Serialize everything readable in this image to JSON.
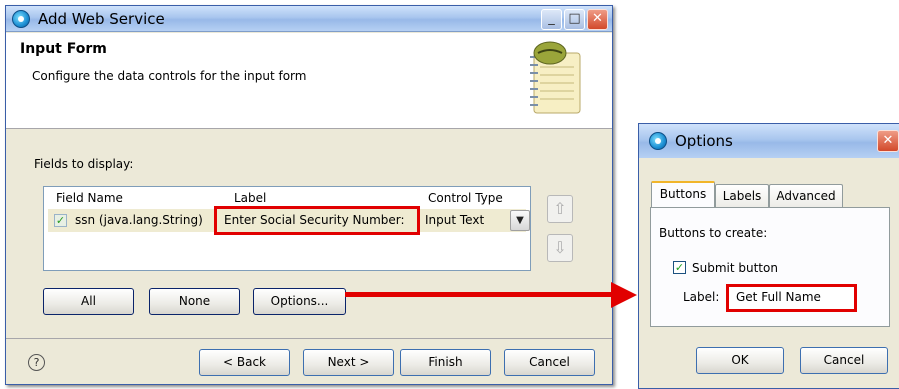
{
  "main": {
    "title": "Add Web Service",
    "header_title": "Input Form",
    "header_desc": "Configure the data controls for the input form",
    "fields_label": "Fields to display:",
    "columns": [
      "Field Name",
      "Label",
      "Control Type"
    ],
    "row": {
      "field_name": "ssn (java.lang.String)",
      "label": "Enter Social Security Number:",
      "control_type": "Input Text"
    },
    "buttons": {
      "all": "All",
      "none": "None",
      "options": "Options..."
    },
    "footer": {
      "back": "< Back",
      "next": "Next >",
      "finish": "Finish",
      "cancel": "Cancel"
    }
  },
  "options": {
    "title": "Options",
    "tabs": [
      "Buttons",
      "Labels",
      "Advanced"
    ],
    "buttons_to_create": "Buttons to create:",
    "submit_checkbox": "Submit button",
    "label_caption": "Label:",
    "label_value": "Get Full Name",
    "ok": "OK",
    "cancel": "Cancel"
  },
  "icons": {
    "title": "web-service-icon",
    "help": "help-icon",
    "up": "arrow-up-icon",
    "down": "arrow-down-icon"
  },
  "colors": {
    "highlight": "#e10000",
    "titlebar": "#a9c6ee"
  }
}
